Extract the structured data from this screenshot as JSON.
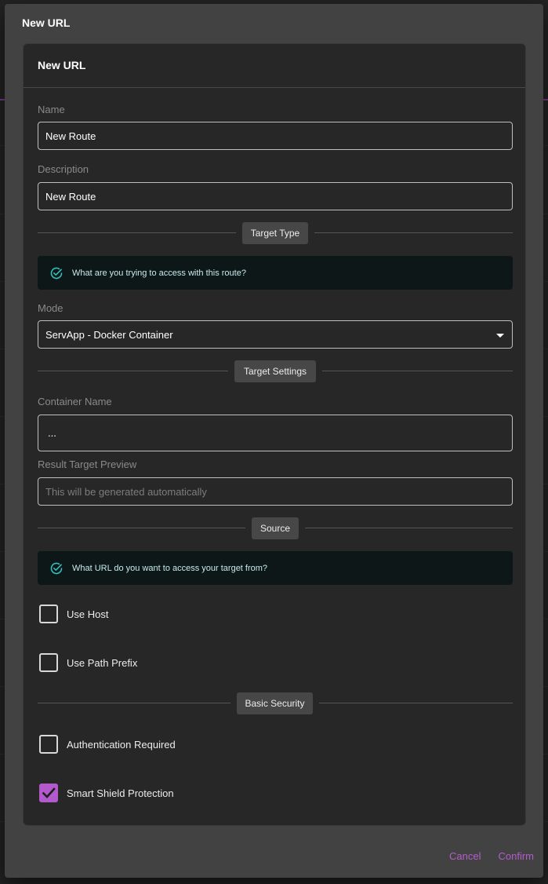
{
  "dialog": {
    "title": "New URL"
  },
  "card": {
    "title": "New URL",
    "name_label": "Name",
    "name_value": "New Route",
    "description_label": "Description",
    "description_value": "New Route",
    "target_type_chip": "Target Type",
    "target_type_info": "What are you trying to access with this route?",
    "mode_label": "Mode",
    "mode_value": "ServApp - Docker Container",
    "target_settings_chip": "Target Settings",
    "container_name_label": "Container Name",
    "container_name_value": "...",
    "result_preview_label": "Result Target Preview",
    "result_preview_placeholder": "This will be generated automatically",
    "source_chip": "Source",
    "source_info": "What URL do you want to access your target from?",
    "use_host_label": "Use Host",
    "use_path_prefix_label": "Use Path Prefix",
    "basic_security_chip": "Basic Security",
    "auth_required_label": "Authentication Required",
    "smart_shield_label": "Smart Shield Protection"
  },
  "checkboxes": {
    "use_host": false,
    "use_path_prefix": false,
    "auth_required": false,
    "smart_shield": true
  },
  "actions": {
    "cancel_label": "Cancel",
    "confirm_label": "Confirm"
  },
  "colors": {
    "accent": "#b35ec9",
    "info_bg": "#0e1717",
    "info_icon": "#2fbfbf"
  },
  "icons": {
    "info": "check-circle-icon",
    "select": "caret-down-icon",
    "checked": "checkmark-icon"
  }
}
